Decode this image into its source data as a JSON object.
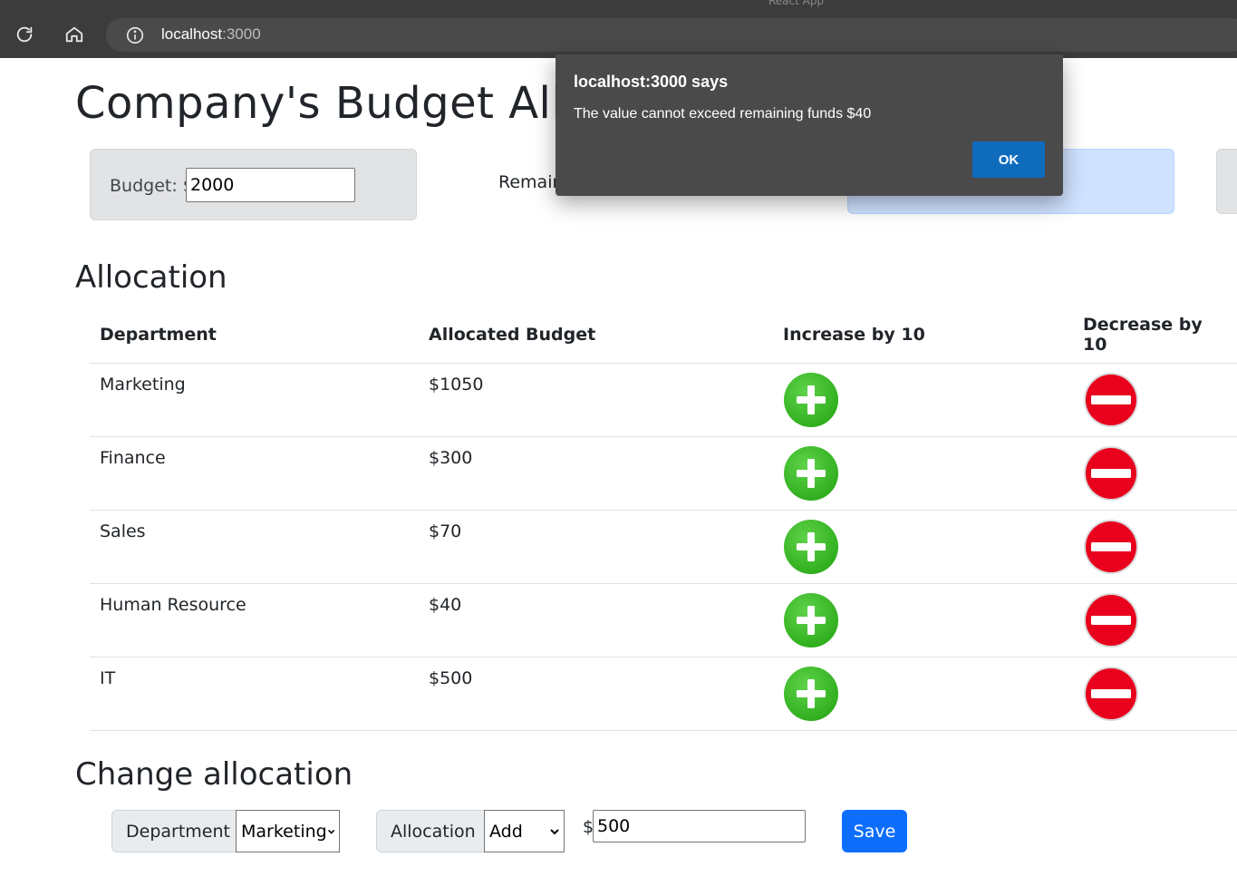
{
  "browser": {
    "tab_title": "React App",
    "url_host": "localhost",
    "url_port": ":3000"
  },
  "page": {
    "title": "Company's Budget Allocation",
    "budget": {
      "label": "Budget: $",
      "value": "2000"
    },
    "remaining_label": "Remaining: $40"
  },
  "allocation": {
    "heading": "Allocation",
    "columns": [
      "Department",
      "Allocated Budget",
      "Increase by 10",
      "Decrease by 10"
    ],
    "rows": [
      {
        "department": "Marketing",
        "budget": "$1050"
      },
      {
        "department": "Finance",
        "budget": "$300"
      },
      {
        "department": "Sales",
        "budget": "$70"
      },
      {
        "department": "Human Resource",
        "budget": "$40"
      },
      {
        "department": "IT",
        "budget": "$500"
      }
    ]
  },
  "change_allocation": {
    "heading": "Change allocation",
    "department_label": "Department",
    "department_selected": "Marketing",
    "allocation_label": "Allocation",
    "allocation_selected": "Add",
    "currency": "$",
    "amount": "500",
    "save_label": "Save"
  },
  "dialog": {
    "title": "localhost:3000 says",
    "message": "The value cannot exceed remaining funds $40",
    "ok_label": "OK"
  },
  "colors": {
    "increase": "#2cab1a",
    "decrease": "#e8001c",
    "primary": "#0d6efd",
    "dialog_bg": "#4a4a4a",
    "dialog_ok": "#0f6cbd"
  }
}
